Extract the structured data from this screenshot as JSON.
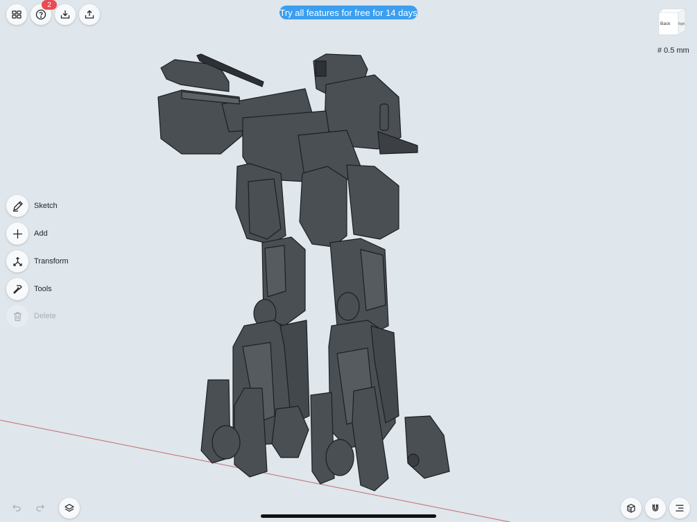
{
  "topbar": {
    "help_badge": "2",
    "trial_banner": "Try all features for free for 14 days"
  },
  "view_cube": {
    "face_back": "Back",
    "face_right": "Right"
  },
  "grid": {
    "label": "# 0.5 mm"
  },
  "tools": [
    {
      "label": "Sketch",
      "icon": "pencil-icon",
      "enabled": true
    },
    {
      "label": "Add",
      "icon": "plus-icon",
      "enabled": true
    },
    {
      "label": "Transform",
      "icon": "transform-icon",
      "enabled": true
    },
    {
      "label": "Tools",
      "icon": "hammer-icon",
      "enabled": true
    },
    {
      "label": "Delete",
      "icon": "trash-icon",
      "enabled": false
    }
  ],
  "colors": {
    "background": "#dfe6ec",
    "accent": "#3b9ef0",
    "badge": "#ea4b52",
    "model": "#4a4f54"
  }
}
